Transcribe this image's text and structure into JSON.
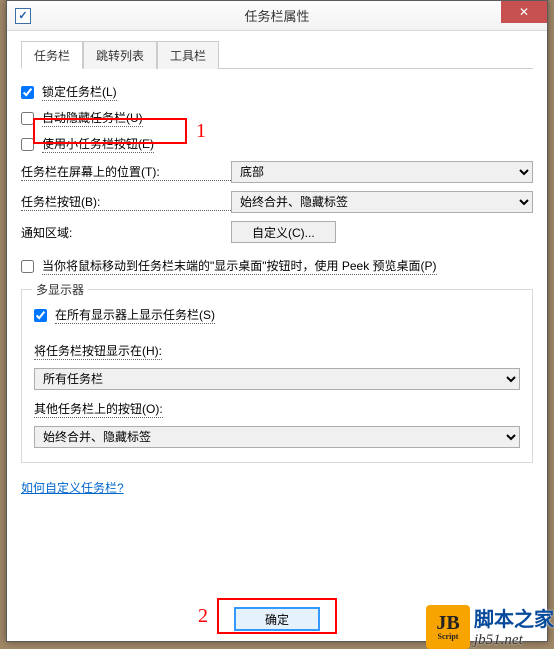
{
  "window": {
    "title": "任务栏属性"
  },
  "tabs": {
    "taskbar": "任务栏",
    "jumplist": "跳转列表",
    "toolbars": "工具栏"
  },
  "options": {
    "lock_taskbar": "锁定任务栏(L)",
    "auto_hide": "自动隐藏任务栏(U)",
    "small_buttons": "使用小任务栏按钮(E)",
    "peek_preview": "当你将鼠标移动到任务栏末端的\"显示桌面\"按钮时，使用 Peek 预览桌面(P)"
  },
  "labels": {
    "position": "任务栏在屏幕上的位置(T):",
    "buttons": "任务栏按钮(B):",
    "notification": "通知区域:",
    "customize_btn": "自定义(C)...",
    "multi_legend": "多显示器",
    "show_on_all": "在所有显示器上显示任务栏(S)",
    "show_buttons_on": "将任务栏按钮显示在(H):",
    "other_buttons": "其他任务栏上的按钮(O):",
    "help_link": "如何自定义任务栏?",
    "ok_btn": "确定"
  },
  "values": {
    "position_selected": "底部",
    "buttons_selected": "始终合并、隐藏标签",
    "show_buttons_on_selected": "所有任务栏",
    "other_buttons_selected": "始终合并、隐藏标签"
  },
  "checked": {
    "lock": true,
    "autohide": false,
    "small": false,
    "peek": false,
    "show_all": true
  },
  "annotations": {
    "num1": "1",
    "num2": "2"
  },
  "watermark": {
    "logo_big": "JB",
    "logo_small": "Script",
    "cn": "脚本之家",
    "url": "jb51.net"
  }
}
